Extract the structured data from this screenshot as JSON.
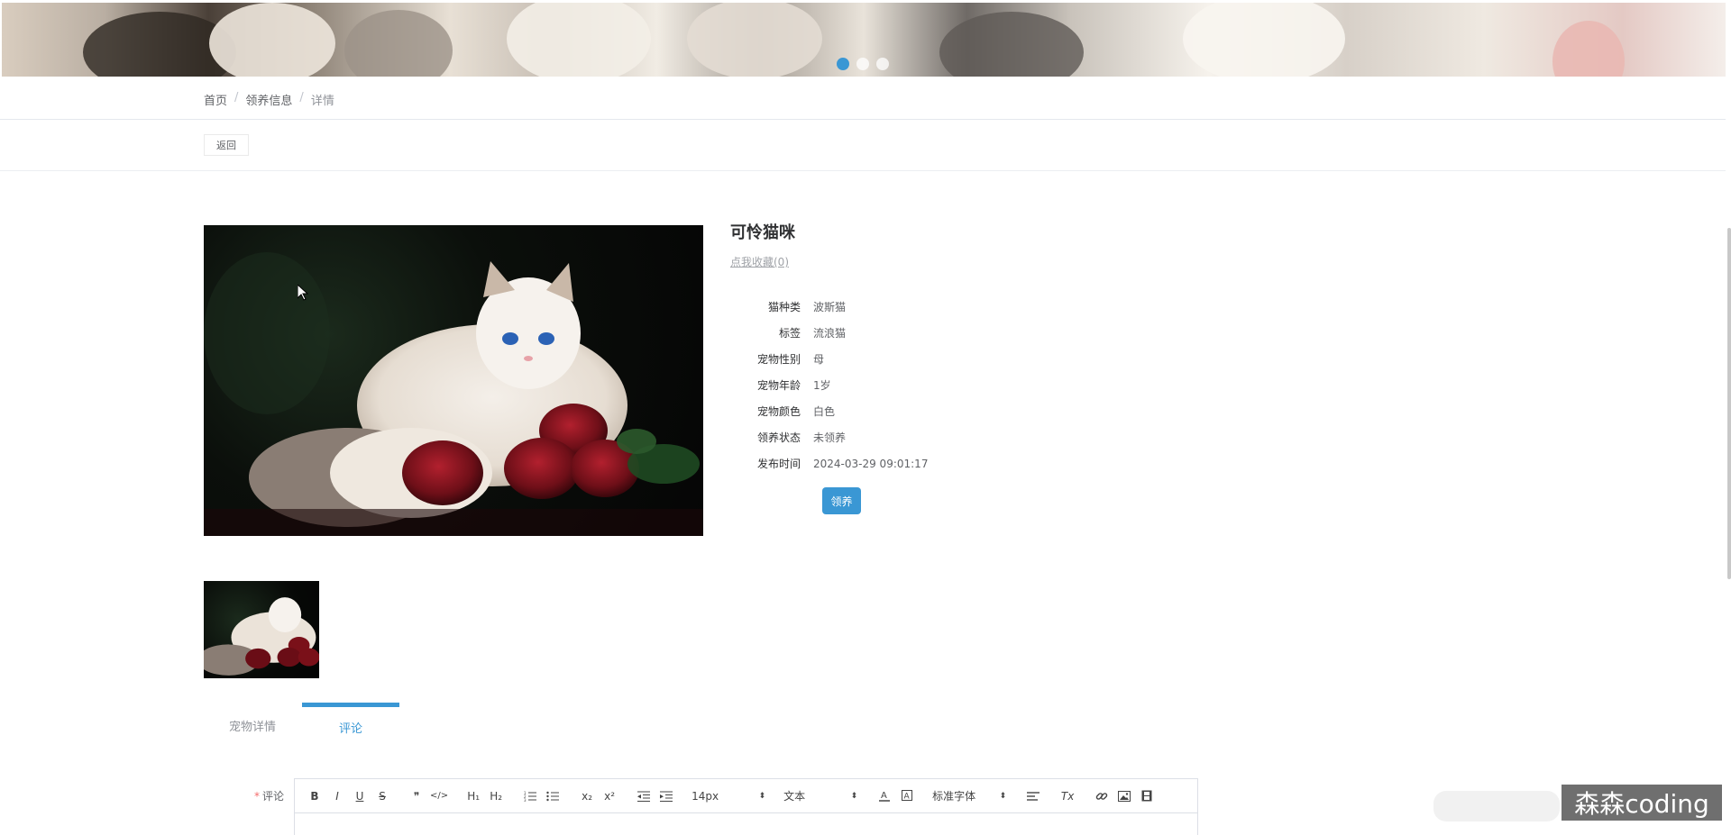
{
  "banner": {
    "carousel_dots": [
      true,
      false,
      false
    ]
  },
  "breadcrumb": {
    "home": "首页",
    "section": "领养信息",
    "current": "详情",
    "sep": "/"
  },
  "back_label": "返回",
  "pet": {
    "name": "可怜猫咪",
    "favorite_label": "点我收藏(0)",
    "fields": [
      {
        "label": "猫种类",
        "value": "波斯猫"
      },
      {
        "label": "标签",
        "value": "流浪猫"
      },
      {
        "label": "宠物性别",
        "value": "母"
      },
      {
        "label": "宠物年龄",
        "value": "1岁"
      },
      {
        "label": "宠物颜色",
        "value": "白色"
      },
      {
        "label": "领养状态",
        "value": "未领养"
      },
      {
        "label": "发布时间",
        "value": "2024-03-29 09:01:17"
      }
    ],
    "adopt_label": "领养"
  },
  "tabs": [
    {
      "label": "宠物详情",
      "active": false
    },
    {
      "label": "评论",
      "active": true
    }
  ],
  "comment": {
    "label": "评论",
    "required_mark": "*",
    "toolbar": {
      "bold": "B",
      "italic": "I",
      "underline": "U",
      "strike": "S",
      "quote": "❞",
      "code": "</>",
      "h1": "H₁",
      "h2": "H₂",
      "sub": "x₂",
      "sup": "x²",
      "size": "14px",
      "header": "文本",
      "font": "标准字体",
      "clean": "Tx"
    }
  },
  "watermark": "森森coding",
  "colors": {
    "accent": "#3a97d4",
    "required": "#f56c6c"
  }
}
